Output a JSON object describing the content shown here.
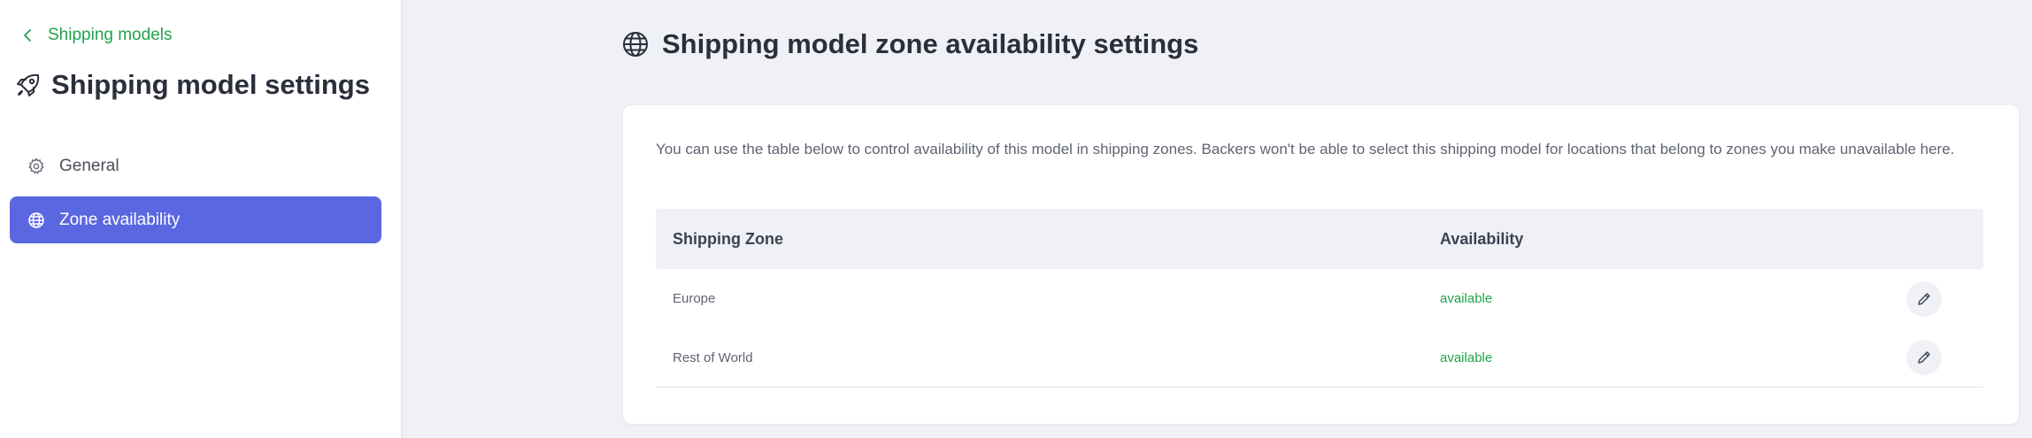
{
  "sidebar": {
    "back_label": "Shipping models",
    "title": "Shipping model settings",
    "items": [
      {
        "label": "General",
        "icon": "gear-icon",
        "active": false
      },
      {
        "label": "Zone availability",
        "icon": "globe-icon",
        "active": true
      }
    ]
  },
  "main": {
    "title": "Shipping model zone availability settings",
    "description": "You can use the table below to control availability of this model in shipping zones. Backers won't be able to select this shipping model for locations that belong to zones you make unavailable here.",
    "table": {
      "headers": [
        "Shipping Zone",
        "Availability"
      ],
      "rows": [
        {
          "zone": "Europe",
          "availability": "available"
        },
        {
          "zone": "Rest of World",
          "availability": "available"
        }
      ]
    }
  },
  "colors": {
    "accent": "#5b67e1",
    "success": "#22a34a",
    "background": "#f0f1f6"
  }
}
